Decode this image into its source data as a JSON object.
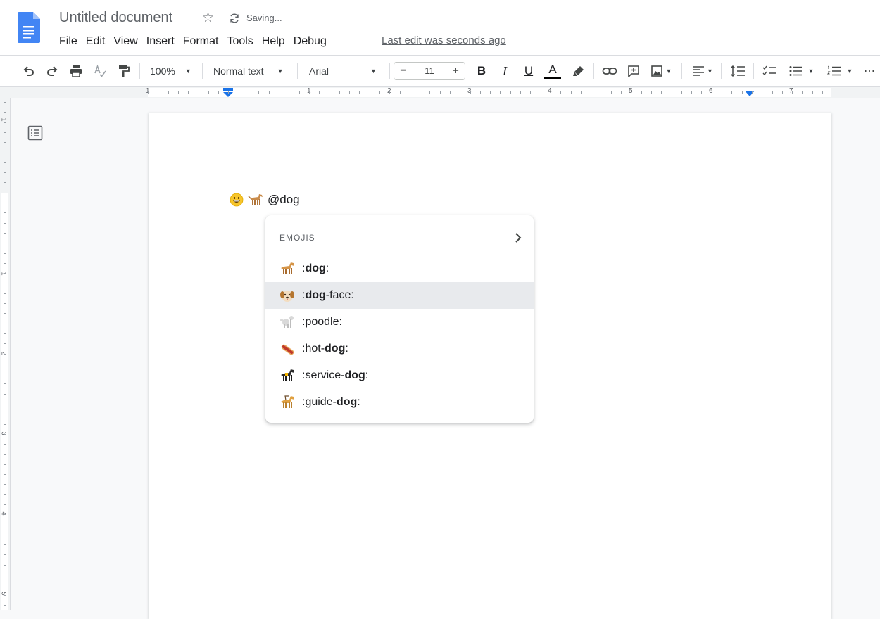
{
  "header": {
    "title": "Untitled document",
    "saving_text": "Saving...",
    "last_edit": "Last edit was seconds ago",
    "menu": [
      "File",
      "Edit",
      "View",
      "Insert",
      "Format",
      "Tools",
      "Help",
      "Debug"
    ]
  },
  "toolbar": {
    "zoom": "100%",
    "style": "Normal text",
    "font": "Arial",
    "font_size": "11",
    "decrease": "−",
    "increase": "+",
    "bold": "B",
    "italic": "I",
    "underline": "U",
    "text_color": "A",
    "more": "⋯"
  },
  "ruler": {
    "h_numbers": [
      "1",
      "1",
      "2",
      "3",
      "4",
      "5",
      "6",
      "7"
    ],
    "v_numbers": [
      "1",
      "1",
      "2",
      "3",
      "4",
      "5"
    ]
  },
  "document": {
    "typed_text": "@dog"
  },
  "emoji_popup": {
    "header": "EMOJIS",
    "items": [
      {
        "icon": "dog-emoji",
        "prefix": ":",
        "match": "dog",
        "suffix": ":"
      },
      {
        "icon": "dog-face-emoji",
        "prefix": ":",
        "match": "dog",
        "suffix": "-face:"
      },
      {
        "icon": "poodle-emoji",
        "prefix": ":poodle:",
        "match": "",
        "suffix": ""
      },
      {
        "icon": "hot-dog-emoji",
        "prefix": ":hot-",
        "match": "dog",
        "suffix": ":"
      },
      {
        "icon": "service-dog-emoji",
        "prefix": ":service-",
        "match": "dog",
        "suffix": ":"
      },
      {
        "icon": "guide-dog-emoji",
        "prefix": ":guide-",
        "match": "dog",
        "suffix": ":"
      }
    ],
    "selected_index": 1
  },
  "colors": {
    "docs_blue": "#4285f4",
    "accent_blue": "#1a73e8",
    "selected_row": "#e8eaed"
  }
}
